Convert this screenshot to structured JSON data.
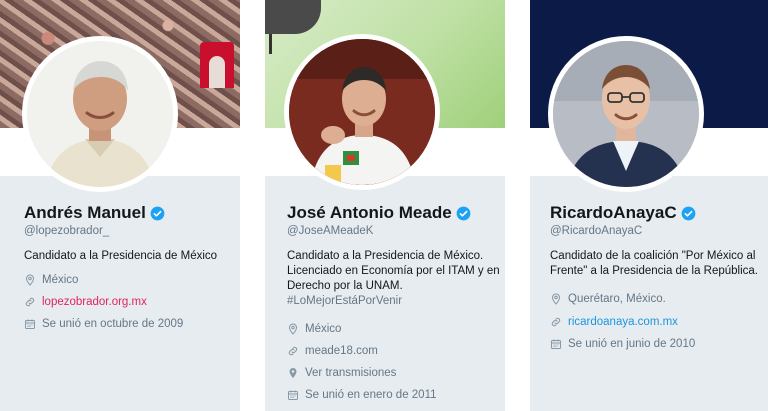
{
  "profiles": [
    {
      "name": "Andrés Manuel",
      "handle": "@lopezobrador_",
      "bio": [
        "Candidato a la Presidencia de México"
      ],
      "location": "México",
      "website": "lopezobrador.org.mx",
      "joined": "Se unió en octubre de 2009",
      "link_color": "#e0245e"
    },
    {
      "name": "José Antonio Meade",
      "handle": "@JoseAMeadeK",
      "bio": [
        "Candidato a la Presidencia de México.",
        "Licenciado en Economía por el ITAM y en",
        "Derecho por la UNAM."
      ],
      "hashtag": "#LoMejorEstáPorVenir",
      "location": "México",
      "website": "meade18.com",
      "broadcasts": "Ver transmisiones",
      "joined": "Se unió en enero de 2011",
      "link_color": "#657786"
    },
    {
      "name": "RicardoAnayaC",
      "handle": "@RicardoAnayaC",
      "bio": [
        "Candidato de la coalición \"Por México al",
        "Frente\" a la Presidencia de la República."
      ],
      "location": "Querétaro, México.",
      "website": "ricardoanaya.com.mx",
      "joined": "Se unió en junio de 2010",
      "link_color": "#1b95e0"
    }
  ],
  "colors": {
    "verified": "#1da1f2",
    "muted": "#657786",
    "card_bg": "#e6ecf0"
  },
  "icons": [
    "verified-badge-icon",
    "location-pin-icon",
    "link-icon",
    "calendar-icon",
    "broadcast-pin-icon"
  ]
}
